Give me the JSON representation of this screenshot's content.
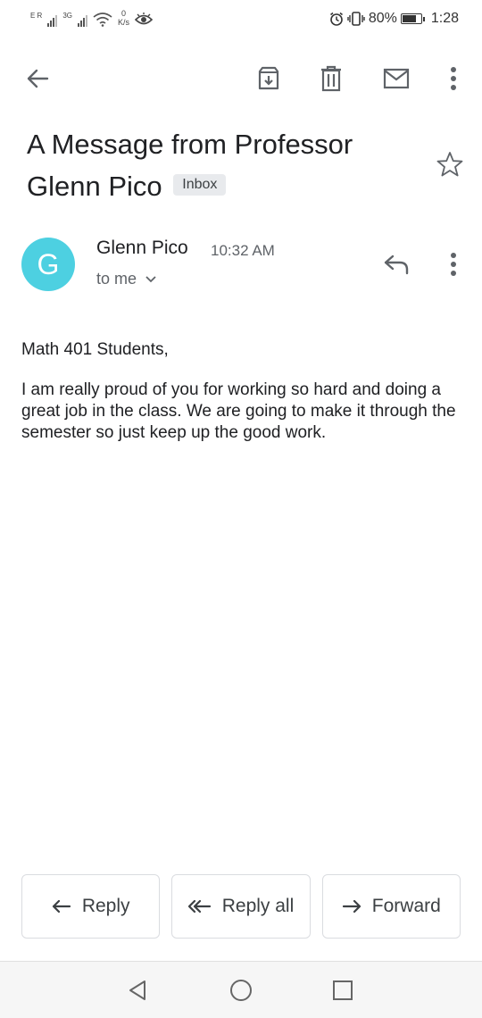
{
  "status_bar": {
    "net_labels": [
      "E R",
      "3G"
    ],
    "speed_value": "0",
    "speed_unit": "K/s",
    "battery_percent": "80%",
    "battery_level": 0.8,
    "time": "1:28"
  },
  "toolbar": {
    "icons": [
      "back-arrow-icon",
      "archive-icon",
      "delete-icon",
      "mail-icon",
      "more-vert-icon"
    ]
  },
  "email": {
    "subject": "A Message from Professor Glenn Pico",
    "label_chip": "Inbox",
    "avatar_letter": "G",
    "avatar_color": "#4dd0e1",
    "sender": "Glenn Pico",
    "time": "10:32 AM",
    "recipient_line": "to me",
    "body": [
      "Math 401 Students,",
      "I am really proud of you for working so hard and doing a great job in the class. We are going to make it through the semester so just keep up the good work."
    ]
  },
  "actions": {
    "reply": "Reply",
    "reply_all": "Reply all",
    "forward": "Forward"
  },
  "nav": {
    "icons": [
      "back-triangle-icon",
      "home-circle-icon",
      "recents-square-icon"
    ]
  }
}
